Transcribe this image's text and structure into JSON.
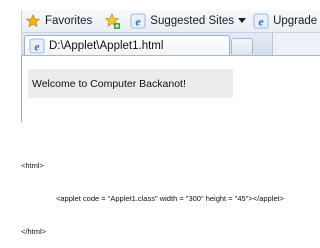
{
  "favorites_bar": {
    "favorites_label": "Favorites",
    "suggested_sites_label": "Suggested Sites",
    "upgrade_label": "Upgrade Your Bro"
  },
  "tab": {
    "title": "D:\\Applet\\Applet1.html"
  },
  "applet": {
    "text": "Welcome to Computer Backanot!"
  },
  "code": {
    "line1": "<html>",
    "line2": "<applet code = \"Applet1.class\" width = \"300\" height = \"45\"></applet>",
    "line3": "</html>"
  },
  "colors": {
    "favorites_star": "#f2b21a",
    "ie_blue": "#2a6fc9",
    "applet_bg": "#ececec"
  },
  "icons": [
    "favorites-star-icon",
    "add-favorite-icon",
    "ie-logo-icon",
    "dropdown-arrow-icon",
    "ie-page-icon"
  ]
}
